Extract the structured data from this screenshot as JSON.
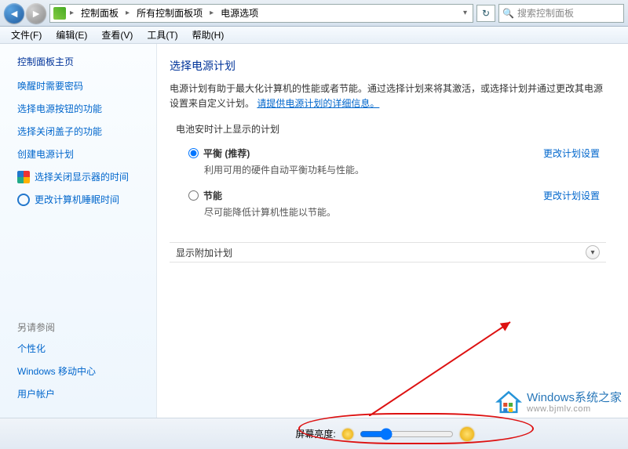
{
  "address": {
    "icon": "control-panel-icon",
    "crumbs": [
      "控制面板",
      "所有控制面板项",
      "电源选项"
    ],
    "refresh": "↻"
  },
  "search": {
    "placeholder": "搜索控制面板"
  },
  "menu": [
    "文件(F)",
    "编辑(E)",
    "查看(V)",
    "工具(T)",
    "帮助(H)"
  ],
  "sidebar": {
    "home": "控制面板主页",
    "links": [
      "唤醒时需要密码",
      "选择电源按钮的功能",
      "选择关闭盖子的功能",
      "创建电源计划",
      "选择关闭显示器的时间",
      "更改计算机睡眠时间"
    ],
    "see_also_label": "另请参阅",
    "see_also": [
      "个性化",
      "Windows 移动中心",
      "用户帐户"
    ]
  },
  "content": {
    "heading": "选择电源计划",
    "desc_a": "电源计划有助于最大化计算机的性能或者节能。通过选择计划来将其激活，或选择计划并通过更改其电源设置来自定义计划。",
    "desc_link": "请提供电源计划的详细信息。",
    "group_label": "电池安时计上显示的计划",
    "plans": [
      {
        "id": "balanced",
        "label": "平衡 (推荐)",
        "sub": "利用可用的硬件自动平衡功耗与性能。",
        "checked": true,
        "change": "更改计划设置"
      },
      {
        "id": "saver",
        "label": "节能",
        "sub": "尽可能降低计算机性能以节能。",
        "checked": false,
        "change": "更改计划设置"
      }
    ],
    "expander": "显示附加计划"
  },
  "bottom": {
    "brightness_label": "屏幕亮度:"
  },
  "watermark": {
    "line1": "Windows系统之家",
    "line2": "www.bjmlv.com"
  }
}
